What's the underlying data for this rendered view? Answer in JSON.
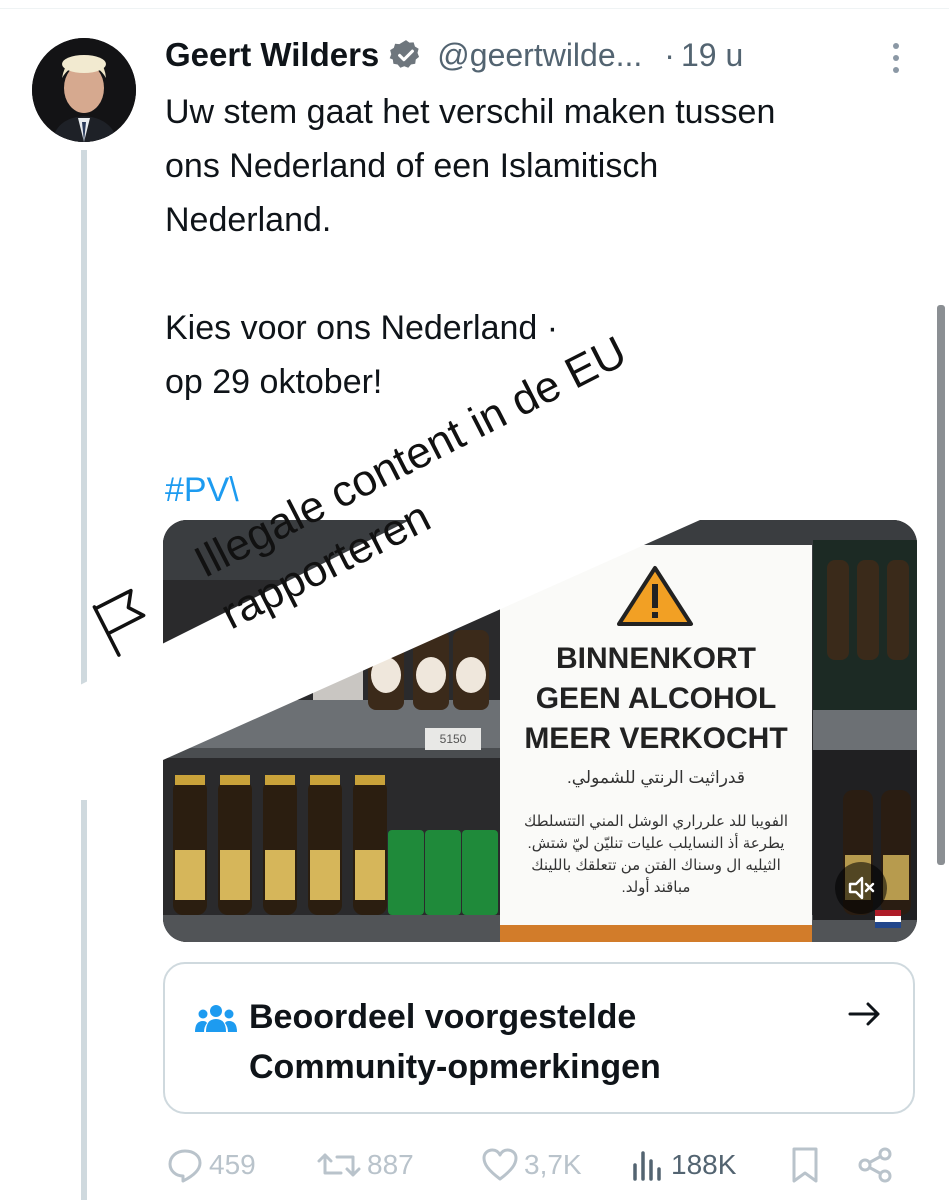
{
  "tweet": {
    "author_name": "Geert Wilders",
    "handle": "@geertwilde...",
    "separator": "·",
    "time": "19 u",
    "text_lines": [
      "Uw stem gaat het verschil maken tussen",
      "ons Nederland of een Islamitisch",
      "Nederland."
    ],
    "text_lines_2": [
      "Kies voor ons Nederland ·",
      "op 29 oktober!"
    ],
    "hashtag": "#PV\\ "
  },
  "overlay": {
    "line1": "Illegale content in de EU",
    "line2": "rapporteren"
  },
  "media": {
    "sign_line1": "BINNENKORT",
    "sign_line2": "GEEN ALCOHOL",
    "sign_line3": "MEER VERKOCHT",
    "arabic1": "قدراثيت الرنتي للشمولي.",
    "arabic2": "الفويبا للد علرراري الوشل المني التتسلطك",
    "arabic3": "يطرعة أذ النسايلب عليات تنليّن ليّ شتش.",
    "arabic4": "الثيليه ال وسناك الفتن من تتعلقك باللينك",
    "arabic5": "مباقند أولد.",
    "price_tag": "5150"
  },
  "community_notes": {
    "line1": "Beoordeel voorgestelde",
    "line2": "Community-opmerkingen"
  },
  "actions": {
    "replies": "459",
    "reposts": "887",
    "likes": "3,7K",
    "views": "188K"
  },
  "colors": {
    "accent": "#1d9bf0",
    "text": "#0f1419",
    "secondary": "#536471",
    "thread_line": "#cfd9de"
  }
}
